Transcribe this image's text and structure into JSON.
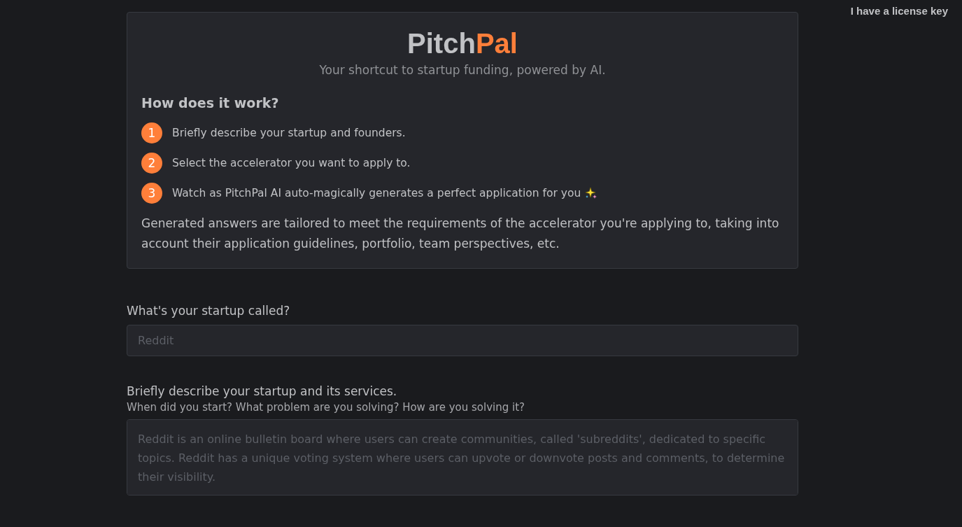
{
  "header_link": "I have a license key",
  "logo": {
    "parts": [
      "Pitch",
      "Pal"
    ]
  },
  "tagline": "Your shortcut to startup funding, powered by AI.",
  "how": {
    "heading": "How does it work?",
    "steps": [
      {
        "number": "1",
        "text": "Briefly describe your startup and founders.",
        "sparkle": false
      },
      {
        "number": "2",
        "text": "Select the accelerator you want to apply to.",
        "sparkle": false
      },
      {
        "number": "3",
        "text": "Watch as PitchPal AI auto-magically generates a perfect application for you",
        "sparkle": true
      }
    ],
    "note": "Generated answers are tailored to meet the requirements of the accelerator you're applying to, taking into account their application guidelines, portfolio, team perspectives, etc."
  },
  "fields": [
    {
      "kind": "input",
      "label": "What's your startup called?",
      "placeholder": "Reddit"
    },
    {
      "kind": "textarea",
      "label": "Briefly describe your startup and its services.",
      "hint": "When did you start? What problem are you solving? How are you solving it?",
      "placeholder": "Reddit is an online bulletin board where users can create communities, called 'subreddits', dedicated to specific topics. Reddit has a unique voting system where users can upvote or downvote posts and comments, to determine their visibility."
    }
  ]
}
